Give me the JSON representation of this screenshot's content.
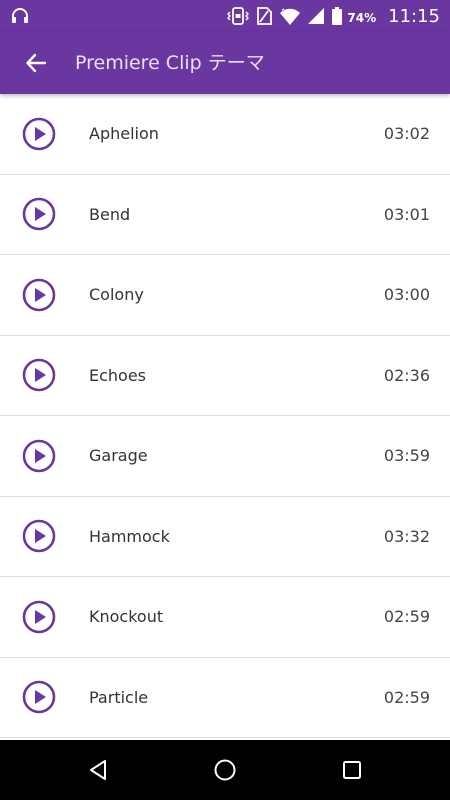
{
  "status_bar": {
    "battery_percent": "74%",
    "time": "11:15",
    "icons": [
      "headphones-icon",
      "vibrate-icon",
      "sim-icon",
      "wifi-icon",
      "cell-signal-icon",
      "battery-icon"
    ]
  },
  "app_bar": {
    "title": "Premiere Clip テーマ",
    "back_icon": "arrow-left-icon"
  },
  "colors": {
    "accent": "#6a36a0",
    "play_icon": "#6a36a0"
  },
  "themes": [
    {
      "name": "Aphelion",
      "duration": "03:02"
    },
    {
      "name": "Bend",
      "duration": "03:01"
    },
    {
      "name": "Colony",
      "duration": "03:00"
    },
    {
      "name": "Echoes",
      "duration": "02:36"
    },
    {
      "name": "Garage",
      "duration": "03:59"
    },
    {
      "name": "Hammock",
      "duration": "03:32"
    },
    {
      "name": "Knockout",
      "duration": "02:59"
    },
    {
      "name": "Particle",
      "duration": "02:59"
    }
  ],
  "nav_bar": {
    "icons": [
      "back-triangle-icon",
      "home-circle-icon",
      "recents-square-icon"
    ]
  }
}
